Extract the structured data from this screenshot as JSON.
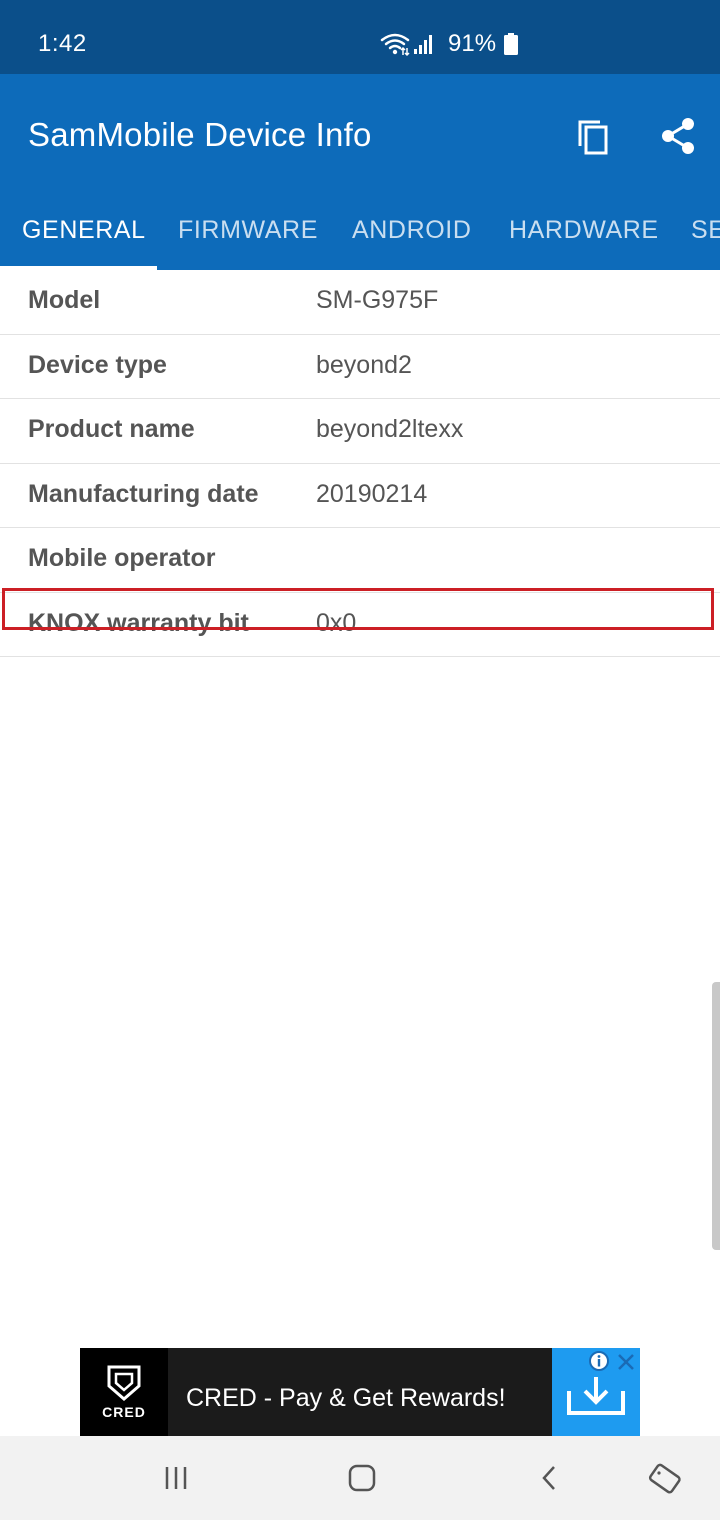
{
  "status_bar": {
    "time": "1:42",
    "battery_percent": "91%",
    "icons": [
      "wifi-icon",
      "signal-icon",
      "battery-icon"
    ]
  },
  "app_bar": {
    "title": "SamMobile Device Info",
    "actions": [
      "copy-icon",
      "share-icon"
    ],
    "background": "#0d6bba"
  },
  "tabs": [
    {
      "label": "GENERAL",
      "active": true
    },
    {
      "label": "FIRMWARE",
      "active": false
    },
    {
      "label": "ANDROID",
      "active": false
    },
    {
      "label": "HARDWARE",
      "active": false
    },
    {
      "label": "SE",
      "active": false
    }
  ],
  "info": [
    {
      "label": "Model",
      "value": "SM-G975F"
    },
    {
      "label": "Device type",
      "value": "beyond2"
    },
    {
      "label": "Product name",
      "value": "beyond2ltexx"
    },
    {
      "label": "Manufacturing date",
      "value": "20190214"
    },
    {
      "label": "Mobile operator",
      "value": ""
    },
    {
      "label": "KNOX warranty bit",
      "value": "0x0",
      "highlighted": true
    }
  ],
  "highlight_color": "#cc1f25",
  "ad": {
    "brand": "CRED",
    "text": "CRED - Pay & Get Rewards!",
    "icons": [
      "info-icon",
      "close-icon",
      "download-icon"
    ]
  },
  "nav_bar": {
    "buttons": [
      "recents-icon",
      "home-icon",
      "back-icon",
      "rotate-icon"
    ]
  }
}
